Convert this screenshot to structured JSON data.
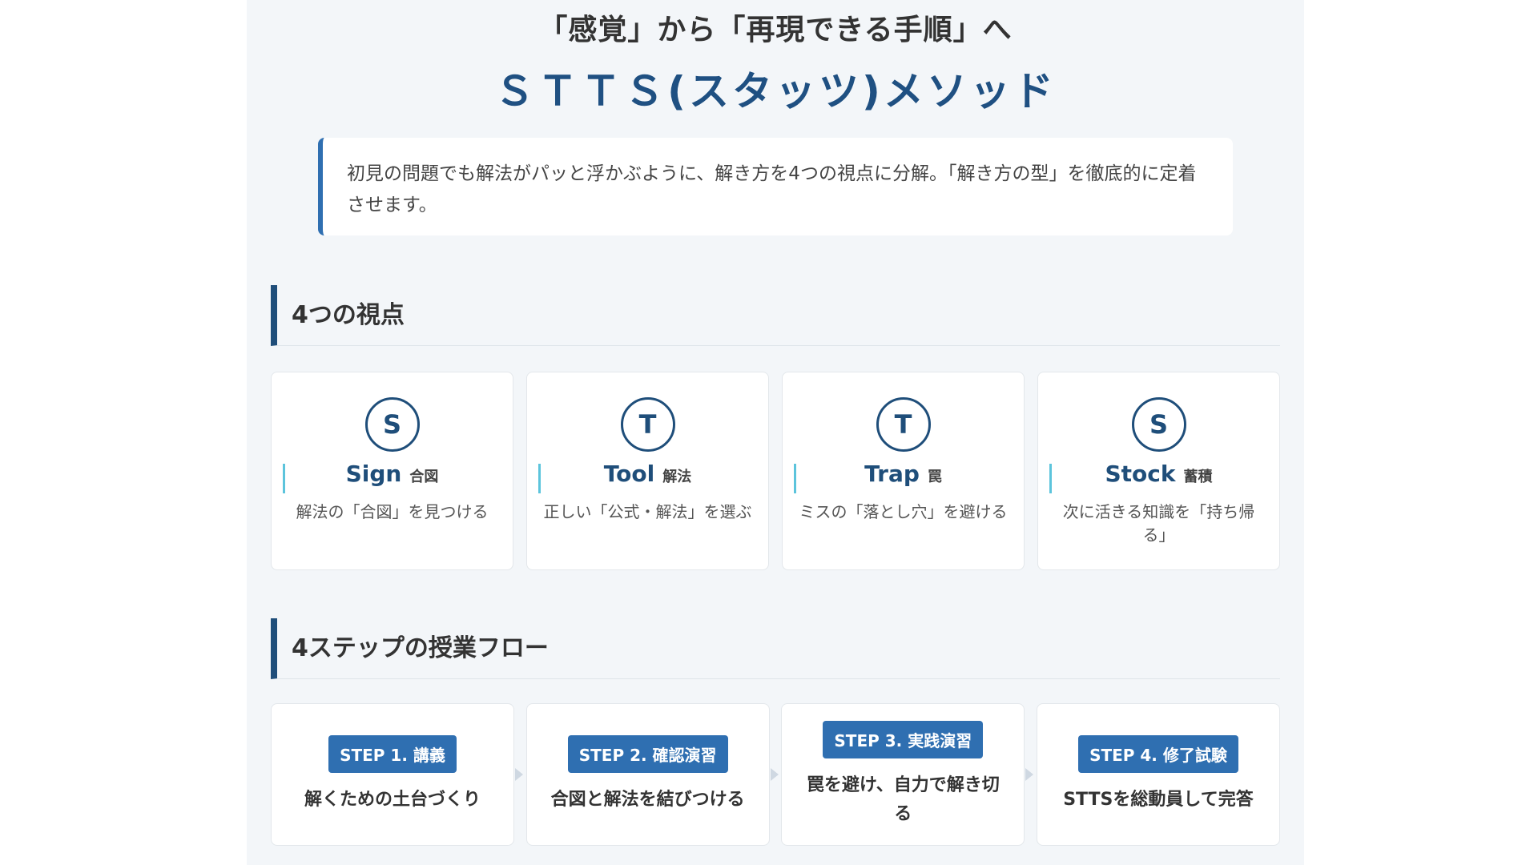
{
  "hero": {
    "subtitle": "「感覚」から「再現できる手順」へ",
    "title": "ＳＴＴＳ(スタッツ)メソッド"
  },
  "intro": {
    "text": "初見の問題でも解法がパッと浮かぶように、解き方を4つの視点に分解。「解き方の型」を徹底的に定着させます。"
  },
  "viewpoints": {
    "heading": "4つの視点",
    "items": [
      {
        "letter": "S",
        "name": "Sign",
        "jp": "合図",
        "desc": "解法の「合図」を見つける"
      },
      {
        "letter": "T",
        "name": "Tool",
        "jp": "解法",
        "desc": "正しい「公式・解法」を選ぶ"
      },
      {
        "letter": "T",
        "name": "Trap",
        "jp": "罠",
        "desc": "ミスの「落とし穴」を避ける"
      },
      {
        "letter": "S",
        "name": "Stock",
        "jp": "蓄積",
        "desc": "次に活きる知識を「持ち帰る」"
      }
    ]
  },
  "flow": {
    "heading": "4ステップの授業フロー",
    "steps": [
      {
        "badge": "STEP 1. 講義",
        "text": "解くための土台づくり"
      },
      {
        "badge": "STEP 2. 確認演習",
        "text": "合図と解法を結びつける"
      },
      {
        "badge": "STEP 3. 実践演習",
        "text": "罠を避け、自力で解き切る"
      },
      {
        "badge": "STEP 4. 修了試験",
        "text": "STTSを総動員して完答"
      }
    ]
  },
  "colors": {
    "accent": "#1f4e7a",
    "badge": "#2f6fb1",
    "cyan_accent": "#5cc4dc",
    "panel_bg": "#f3f6f9"
  }
}
